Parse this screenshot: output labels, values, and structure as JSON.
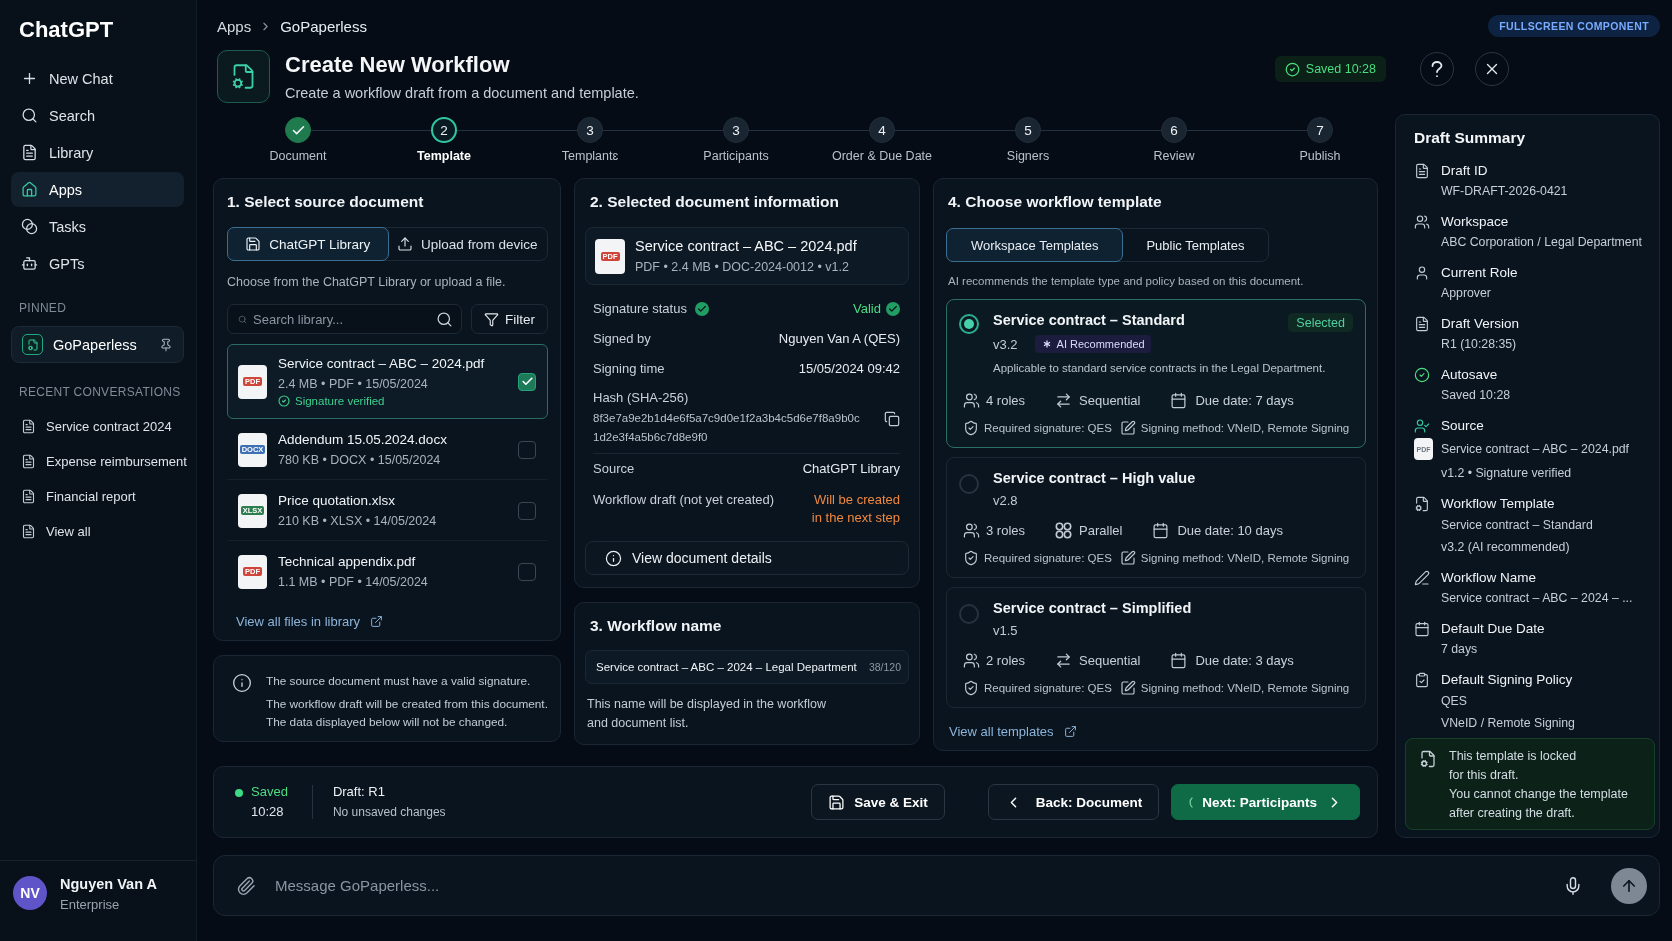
{
  "sidebar": {
    "app_name": "ChatGPT",
    "nav_items": [
      {
        "label": "New Chat",
        "selected": false
      },
      {
        "label": "Search",
        "selected": false
      },
      {
        "label": "Library",
        "selected": false
      },
      {
        "label": "Apps",
        "selected": true
      },
      {
        "label": "Tasks",
        "selected": false
      },
      {
        "label": "GPTs",
        "selected": false
      }
    ],
    "pinned": {
      "heading": "PINNED",
      "items": [
        {
          "label": "GoPaperless",
          "selected": true
        }
      ]
    },
    "recent": {
      "heading": "RECENT CONVERSATIONS",
      "items": [
        {
          "label": "Service contract 2024"
        },
        {
          "label": "Expense reimbursement"
        },
        {
          "label": "Financial report"
        },
        {
          "label": "View all"
        }
      ]
    },
    "user": {
      "initials": "NV",
      "name": "Nguyen Van A",
      "plan": "Enterprise"
    }
  },
  "breadcrumb": [
    "Apps",
    "GoPaperless"
  ],
  "mode_badge": "FULLSCREEN COMPONENT",
  "header": {
    "title": "Create New Workflow",
    "subtitle": "Create a workflow draft from a document and template.",
    "save_status": "Saved 10:28"
  },
  "stepper": [
    {
      "label": "Document",
      "done": true,
      "selected": false
    },
    {
      "number": "2",
      "label": "Template",
      "done": false,
      "selected": true
    },
    {
      "number": "3",
      "label": "Templantɛ",
      "done": false,
      "selected": false
    },
    {
      "number": "3",
      "label": "Participants",
      "done": false,
      "selected": false
    },
    {
      "number": "4",
      "label": "Order & Due Date",
      "done": false,
      "selected": false
    },
    {
      "number": "5",
      "label": "Signers",
      "done": false,
      "selected": false
    },
    {
      "number": "6",
      "label": "Review",
      "done": false,
      "selected": false
    },
    {
      "number": "7",
      "label": "Publish",
      "done": false,
      "selected": false
    }
  ],
  "source_panel": {
    "title": "1. Select source document",
    "tabs": [
      {
        "label": "ChatGPT Library",
        "selected": true
      },
      {
        "label": "Upload from device",
        "selected": false
      }
    ],
    "hint": "Choose from the ChatGPT Library or upload a file.",
    "search": {
      "placeholder": "Search library..."
    },
    "filter_button": "Filter",
    "files": [
      {
        "name": "Service contract – ABC – 2024.pdf",
        "meta": "2.4 MB • PDF • 15/05/2024",
        "type_label": "PDF",
        "color": "#d0453a",
        "selected": true,
        "note": "Signature verified"
      },
      {
        "name": "Addendum 15.05.2024.docx",
        "meta": "780 KB • DOCX • 15/05/2024",
        "type_label": "DOCX",
        "color": "#3f6fb5",
        "selected": false
      },
      {
        "name": "Price quotation.xlsx",
        "meta": "210 KB • XLSX • 14/05/2024",
        "type_label": "XLSX",
        "color": "#2e7d4f",
        "selected": false
      },
      {
        "name": "Technical appendix.pdf",
        "meta": "1.1 MB • PDF • 14/05/2024",
        "type_label": "PDF",
        "color": "#d0453a",
        "selected": false
      }
    ],
    "link": "View all files in library"
  },
  "source_notice": [
    "The source document must have a valid signature.",
    "The workflow draft will be created from this document.",
    "The data displayed below will not be changed."
  ],
  "document_info": {
    "title": "2. Selected document information",
    "file": {
      "name": "Service contract – ABC – 2024.pdf",
      "meta": "PDF • 2.4 MB • DOC-2024-0012 • v1.2",
      "type_label": "PDF"
    },
    "rows": [
      {
        "kind": "status",
        "label": "Signature status",
        "value": "Valid"
      },
      {
        "kind": "text",
        "label": "Signed by",
        "value": "Nguyen Van A (QES)"
      },
      {
        "kind": "text",
        "label": "Signing time",
        "value": "15/05/2024 09:42"
      },
      {
        "kind": "hash",
        "label": "Hash (SHA-256)",
        "value": "8f3e7a9e2b1d4e6f5a7c9d0e1f2a3b4c5d6e7f8a9b0c1d2e3f4a5b6c7d8e9f0"
      },
      {
        "kind": "text",
        "label": "Source",
        "value": "ChatGPT Library"
      },
      {
        "kind": "pending",
        "label": "Workflow draft (not yet created)",
        "value": "Will be created\nin the next step"
      }
    ],
    "details_button": "View document details"
  },
  "workflow_name": {
    "title": "3. Workflow name",
    "value": "Service contract – ABC – 2024 – Legal Department",
    "counter": "38/120",
    "helper": "This name will be displayed in the workflow and document list."
  },
  "templates": {
    "title": "4. Choose workflow template",
    "tabs": [
      {
        "label": "Workspace Templates",
        "selected": true
      },
      {
        "label": "Public Templates",
        "selected": false
      }
    ],
    "hint": "AI recommends the template type and policy based on this document.",
    "items": [
      {
        "name": "Service contract – Standard",
        "version": "v3.2",
        "selected": true,
        "badge": "Selected",
        "ai_badge": "AI Recommended",
        "description": "Applicable to standard service contracts in the Legal Department.",
        "roles": "4 roles",
        "order": {
          "kind": "sequential",
          "label": "Sequential"
        },
        "due": "Due date: 7 days",
        "signature": "Required signature: QES",
        "method": "Signing method: VNeID, Remote Signing"
      },
      {
        "name": "Service contract – High value",
        "version": "v2.8",
        "selected": false,
        "roles": "3 roles",
        "order": {
          "kind": "parallel",
          "label": "Parallel"
        },
        "due": "Due date: 10 days",
        "signature": "Required signature: QES",
        "method": "Signing method: VNeID, Remote Signing"
      },
      {
        "name": "Service contract – Simplified",
        "version": "v1.5",
        "selected": false,
        "roles": "2 roles",
        "order": {
          "kind": "sequential",
          "label": "Sequential"
        },
        "due": "Due date: 3 days",
        "signature": "Required signature: QES",
        "method": "Signing method: VNeID, Remote Signing"
      }
    ],
    "link": "View all templates"
  },
  "summary": {
    "title": "Draft Summary",
    "items": [
      {
        "kind": "text",
        "label": "Draft ID",
        "values": [
          "WF-DRAFT-2026-0421"
        ]
      },
      {
        "kind": "text",
        "label": "Workspace",
        "values": [
          "ABC Corporation / Legal Department"
        ]
      },
      {
        "kind": "text",
        "label": "Current Role",
        "values": [
          "Approver"
        ]
      },
      {
        "kind": "text",
        "label": "Draft Version",
        "values": [
          "R1 (10:28:35)"
        ]
      },
      {
        "kind": "text",
        "label": "Autosave",
        "values": [
          "Saved 10:28"
        ]
      },
      {
        "kind": "file",
        "label": "Source",
        "file_label": "PDF",
        "values": [
          "Service contract – ABC – 2024.pdf",
          "v1.2 • Signature verified"
        ]
      },
      {
        "kind": "text",
        "label": "Workflow Template",
        "values": [
          "Service contract – Standard",
          "v3.2 (AI recommended)"
        ]
      },
      {
        "kind": "text",
        "label": "Workflow Name",
        "values": [
          "Service contract – ABC – 2024 – ..."
        ]
      },
      {
        "kind": "text",
        "label": "Default Due Date",
        "values": [
          "7 days"
        ]
      },
      {
        "kind": "text",
        "label": "Default Signing Policy",
        "values": [
          "QES",
          "VNeID / Remote Signing"
        ]
      }
    ],
    "notice": "This template is locked\nfor this draft.\nYou cannot change the template\nafter creating the draft."
  },
  "action_bar": {
    "save_state": "Saved",
    "save_time": "10:28",
    "draft": "Draft: R1",
    "changes": "No unsaved changes",
    "buttons": [
      {
        "kind": "save",
        "label": "Save & Exit"
      },
      {
        "kind": "back",
        "label": "Back: Document"
      },
      {
        "kind": "next",
        "label": "Next: Participants"
      }
    ]
  },
  "composer": {
    "placeholder": "Message GoPaperless..."
  }
}
